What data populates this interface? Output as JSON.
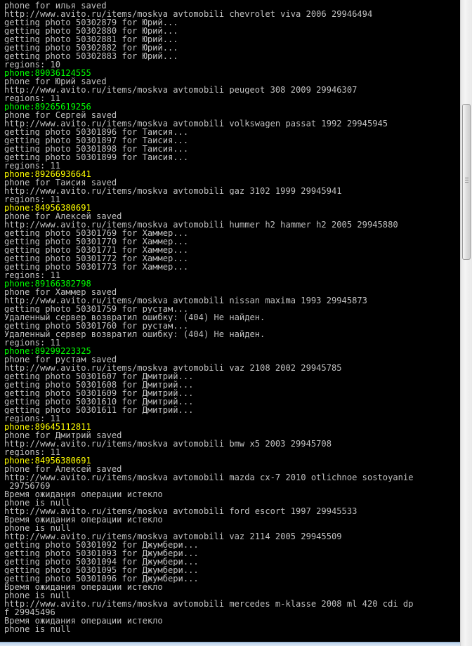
{
  "colors": {
    "background": "#000000",
    "default_text": "#c0c0c0",
    "green_phone": "#00ff00",
    "yellow_phone": "#ffff00"
  },
  "console": {
    "lines": [
      {
        "text": "phone for илья saved",
        "color": "default"
      },
      {
        "text": "http://www.avito.ru/items/moskva_avtomobili_chevrolet_viva_2006_29946494",
        "color": "default"
      },
      {
        "text": "getting photo 50302879 for Юрий...",
        "color": "default"
      },
      {
        "text": "getting photo 50302880 for Юрий...",
        "color": "default"
      },
      {
        "text": "getting photo 50302881 for Юрий...",
        "color": "default"
      },
      {
        "text": "getting photo 50302882 for Юрий...",
        "color": "default"
      },
      {
        "text": "getting photo 50302883 for Юрий...",
        "color": "default"
      },
      {
        "text": "regions: 10",
        "color": "default"
      },
      {
        "text": "phone:89036124555",
        "color": "green"
      },
      {
        "text": "phone for Юрий saved",
        "color": "default"
      },
      {
        "text": "http://www.avito.ru/items/moskva_avtomobili_peugeot_308_2009_29946307",
        "color": "default"
      },
      {
        "text": "regions: 11",
        "color": "default"
      },
      {
        "text": "phone:89265619256",
        "color": "green"
      },
      {
        "text": "phone for Сергей saved",
        "color": "default"
      },
      {
        "text": "http://www.avito.ru/items/moskva_avtomobili_volkswagen_passat_1992_29945945",
        "color": "default"
      },
      {
        "text": "getting photo 50301896 for Таисия...",
        "color": "default"
      },
      {
        "text": "getting photo 50301897 for Таисия...",
        "color": "default"
      },
      {
        "text": "getting photo 50301898 for Таисия...",
        "color": "default"
      },
      {
        "text": "getting photo 50301899 for Таисия...",
        "color": "default"
      },
      {
        "text": "regions: 11",
        "color": "default"
      },
      {
        "text": "phone:89266936641",
        "color": "yellow"
      },
      {
        "text": "phone for Таисия saved",
        "color": "default"
      },
      {
        "text": "http://www.avito.ru/items/moskva_avtomobili_gaz_3102_1999_29945941",
        "color": "default"
      },
      {
        "text": "regions: 11",
        "color": "default"
      },
      {
        "text": "phone:84956380691",
        "color": "yellow"
      },
      {
        "text": "phone for Алексей saved",
        "color": "default"
      },
      {
        "text": "http://www.avito.ru/items/moskva_avtomobili_hummer_h2_hammer_h2_2005_29945880",
        "color": "default"
      },
      {
        "text": "getting photo 50301769 for Хаммер...",
        "color": "default"
      },
      {
        "text": "getting photo 50301770 for Хаммер...",
        "color": "default"
      },
      {
        "text": "getting photo 50301771 for Хаммер...",
        "color": "default"
      },
      {
        "text": "getting photo 50301772 for Хаммер...",
        "color": "default"
      },
      {
        "text": "getting photo 50301773 for Хаммер...",
        "color": "default"
      },
      {
        "text": "regions: 11",
        "color": "default"
      },
      {
        "text": "phone:89166382798",
        "color": "green"
      },
      {
        "text": "phone for Хаммер saved",
        "color": "default"
      },
      {
        "text": "http://www.avito.ru/items/moskva_avtomobili_nissan_maxima_1993_29945873",
        "color": "default"
      },
      {
        "text": "getting photo 50301759 for рустам...",
        "color": "default"
      },
      {
        "text": "Удаленный сервер возвратил ошибку: (404) Не найден.",
        "color": "default"
      },
      {
        "text": "getting photo 50301760 for рустам...",
        "color": "default"
      },
      {
        "text": "Удаленный сервер возвратил ошибку: (404) Не найден.",
        "color": "default"
      },
      {
        "text": "regions: 11",
        "color": "default"
      },
      {
        "text": "phone:89299223325",
        "color": "green"
      },
      {
        "text": "phone for рустам saved",
        "color": "default"
      },
      {
        "text": "http://www.avito.ru/items/moskva_avtomobili_vaz_2108_2002_29945785",
        "color": "default"
      },
      {
        "text": "getting photo 50301607 for Дмитрий...",
        "color": "default"
      },
      {
        "text": "getting photo 50301608 for Дмитрий...",
        "color": "default"
      },
      {
        "text": "getting photo 50301609 for Дмитрий...",
        "color": "default"
      },
      {
        "text": "getting photo 50301610 for Дмитрий...",
        "color": "default"
      },
      {
        "text": "getting photo 50301611 for Дмитрий...",
        "color": "default"
      },
      {
        "text": "regions: 11",
        "color": "default"
      },
      {
        "text": "phone:89645112811",
        "color": "yellow"
      },
      {
        "text": "phone for Дмитрий saved",
        "color": "default"
      },
      {
        "text": "http://www.avito.ru/items/moskva_avtomobili_bmw_x5_2003_29945708",
        "color": "default"
      },
      {
        "text": "regions: 11",
        "color": "default"
      },
      {
        "text": "phone:84956380691",
        "color": "yellow"
      },
      {
        "text": "phone for Алексей saved",
        "color": "default"
      },
      {
        "text": "http://www.avito.ru/items/moskva_avtomobili_mazda_cx-7_2010_otlichnoe_sostoyanie",
        "color": "default"
      },
      {
        "text": "_29756769",
        "color": "default"
      },
      {
        "text": "Время ожидания операции истекло",
        "color": "default"
      },
      {
        "text": "phone is null",
        "color": "default"
      },
      {
        "text": "http://www.avito.ru/items/moskva_avtomobili_ford_escort_1997_29945533",
        "color": "default"
      },
      {
        "text": "Время ожидания операции истекло",
        "color": "default"
      },
      {
        "text": "phone is null",
        "color": "default"
      },
      {
        "text": "http://www.avito.ru/items/moskva_avtomobili_vaz_2114_2005_29945509",
        "color": "default"
      },
      {
        "text": "getting photo 50301092 for Джумбери...",
        "color": "default"
      },
      {
        "text": "getting photo 50301093 for Джумбери...",
        "color": "default"
      },
      {
        "text": "getting photo 50301094 for Джумбери...",
        "color": "default"
      },
      {
        "text": "getting photo 50301095 for Джумбери...",
        "color": "default"
      },
      {
        "text": "getting photo 50301096 for Джумбери...",
        "color": "default"
      },
      {
        "text": "Время ожидания операции истекло",
        "color": "default"
      },
      {
        "text": "phone is null",
        "color": "default"
      },
      {
        "text": "http://www.avito.ru/items/moskva_avtomobili_mercedes_m-klasse_2008_ml_420_cdi_dp",
        "color": "default"
      },
      {
        "text": "f_29945496",
        "color": "default"
      },
      {
        "text": "Время ожидания операции истекло",
        "color": "default"
      },
      {
        "text": "phone is null",
        "color": "default"
      }
    ]
  },
  "scrollbar": {
    "thumb_icon": "scroll-thumb-grip"
  }
}
